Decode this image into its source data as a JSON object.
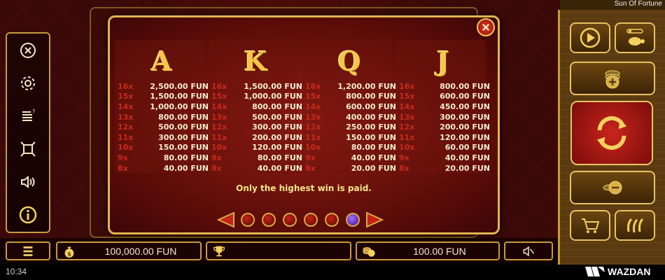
{
  "game": {
    "title": "Sun Of Fortune"
  },
  "status": {
    "time": "10:34",
    "brand": "WAZDAN"
  },
  "sidebar": {
    "items": [
      {
        "name": "close",
        "icon": "close-circle-icon"
      },
      {
        "name": "settings",
        "icon": "gear-icon"
      },
      {
        "name": "paytable",
        "icon": "paytable-icon"
      },
      {
        "name": "fullscreen",
        "icon": "fullscreen-icon"
      },
      {
        "name": "sound",
        "icon": "speaker-icon"
      },
      {
        "name": "info",
        "icon": "info-icon"
      }
    ]
  },
  "bottom": {
    "balance": "100,000.00 FUN",
    "win": "",
    "bet": "100.00 FUN"
  },
  "paytable": {
    "columns": [
      {
        "symbol": "A",
        "rows": [
          {
            "mult": "16x",
            "amount": "2,500.00 FUN"
          },
          {
            "mult": "15x",
            "amount": "1,500.00 FUN"
          },
          {
            "mult": "14x",
            "amount": "1,000.00 FUN"
          },
          {
            "mult": "13x",
            "amount": "800.00 FUN"
          },
          {
            "mult": "12x",
            "amount": "500.00 FUN"
          },
          {
            "mult": "11x",
            "amount": "300.00 FUN"
          },
          {
            "mult": "10x",
            "amount": "150.00 FUN"
          },
          {
            "mult": "9x",
            "amount": "80.00 FUN"
          },
          {
            "mult": "8x",
            "amount": "40.00 FUN"
          }
        ]
      },
      {
        "symbol": "K",
        "rows": [
          {
            "mult": "16x",
            "amount": "1,500.00 FUN"
          },
          {
            "mult": "15x",
            "amount": "1,000.00 FUN"
          },
          {
            "mult": "14x",
            "amount": "800.00 FUN"
          },
          {
            "mult": "13x",
            "amount": "500.00 FUN"
          },
          {
            "mult": "12x",
            "amount": "300.00 FUN"
          },
          {
            "mult": "11x",
            "amount": "200.00 FUN"
          },
          {
            "mult": "10x",
            "amount": "120.00 FUN"
          },
          {
            "mult": "9x",
            "amount": "80.00 FUN"
          },
          {
            "mult": "8x",
            "amount": "40.00 FUN"
          }
        ]
      },
      {
        "symbol": "Q",
        "rows": [
          {
            "mult": "16x",
            "amount": "1,200.00 FUN"
          },
          {
            "mult": "15x",
            "amount": "800.00 FUN"
          },
          {
            "mult": "14x",
            "amount": "600.00 FUN"
          },
          {
            "mult": "13x",
            "amount": "400.00 FUN"
          },
          {
            "mult": "12x",
            "amount": "250.00 FUN"
          },
          {
            "mult": "11x",
            "amount": "150.00 FUN"
          },
          {
            "mult": "10x",
            "amount": "80.00 FUN"
          },
          {
            "mult": "9x",
            "amount": "40.00 FUN"
          },
          {
            "mult": "8x",
            "amount": "20.00 FUN"
          }
        ]
      },
      {
        "symbol": "J",
        "rows": [
          {
            "mult": "16x",
            "amount": "800.00 FUN"
          },
          {
            "mult": "15x",
            "amount": "600.00 FUN"
          },
          {
            "mult": "14x",
            "amount": "450.00 FUN"
          },
          {
            "mult": "13x",
            "amount": "300.00 FUN"
          },
          {
            "mult": "12x",
            "amount": "200.00 FUN"
          },
          {
            "mult": "11x",
            "amount": "120.00 FUN"
          },
          {
            "mult": "10x",
            "amount": "60.00 FUN"
          },
          {
            "mult": "9x",
            "amount": "40.00 FUN"
          },
          {
            "mult": "8x",
            "amount": "20.00 FUN"
          }
        ]
      }
    ],
    "note": "Only the highest win is paid.",
    "pages": {
      "count": 6,
      "current": 6
    }
  },
  "colors": {
    "gold": "#e0b550",
    "multiplier": "#c52a1e",
    "note": "#f6e38a",
    "active_dot": "#8f5cf0"
  }
}
